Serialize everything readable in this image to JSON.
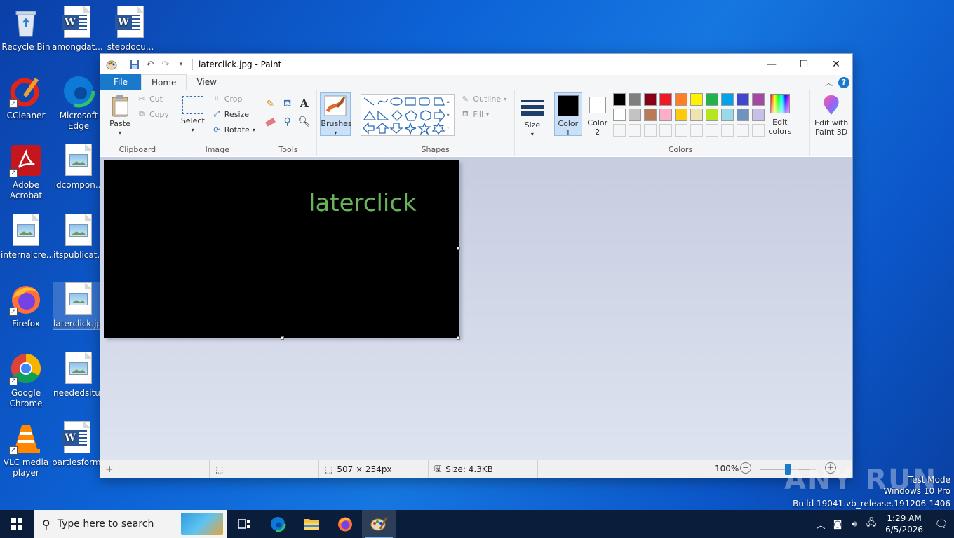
{
  "desktop": {
    "icons": [
      {
        "label": "Recycle Bin"
      },
      {
        "label": "amongdat..."
      },
      {
        "label": "stepdocu..."
      },
      {
        "label": "CCleaner"
      },
      {
        "label": "Microsoft Edge"
      },
      {
        "label": "Adobe Acrobat"
      },
      {
        "label": "idcompon..."
      },
      {
        "label": "internalcre..."
      },
      {
        "label": "itspublicat..."
      },
      {
        "label": "Firefox"
      },
      {
        "label": "laterclick.jpg"
      },
      {
        "label": "Google Chrome"
      },
      {
        "label": "neededsitu..."
      },
      {
        "label": "VLC media player"
      },
      {
        "label": "partiesform..."
      }
    ]
  },
  "paint": {
    "title": "laterclick.jpg - Paint",
    "tabs": {
      "file": "File",
      "home": "Home",
      "view": "View"
    },
    "clipboard": {
      "paste": "Paste",
      "cut": "Cut",
      "copy": "Copy",
      "label": "Clipboard"
    },
    "image": {
      "select": "Select",
      "crop": "Crop",
      "resize": "Resize",
      "rotate": "Rotate",
      "label": "Image"
    },
    "tools": {
      "label": "Tools"
    },
    "brushes": {
      "label": "Brushes"
    },
    "shapes": {
      "outline": "Outline",
      "fill": "Fill",
      "label": "Shapes"
    },
    "size": {
      "label": "Size"
    },
    "colors": {
      "color1": "Color 1",
      "color2": "Color 2",
      "edit": "Edit colors",
      "label": "Colors",
      "color1_value": "#000000",
      "color2_value": "#ffffff",
      "row1": [
        "#000000",
        "#7f7f7f",
        "#880015",
        "#ed1c24",
        "#ff7f27",
        "#fff200",
        "#22b14c",
        "#00a2e8",
        "#3f48cc",
        "#a349a4"
      ],
      "row2": [
        "#ffffff",
        "#c3c3c3",
        "#b97a57",
        "#ffaec9",
        "#ffc90e",
        "#efe4b0",
        "#b5e61d",
        "#99d9ea",
        "#7092be",
        "#c8bfe7"
      ]
    },
    "paint3d": "Edit with Paint 3D",
    "canvas_text": "laterclick",
    "canvas_text_color": "#67b45b",
    "status": {
      "dimensions": "507 × 254px",
      "size": "Size: 4.3KB",
      "zoom": "100%"
    }
  },
  "watermark": {
    "logo": "ANY RUN",
    "line1": "Test Mode",
    "line2": "Windows 10 Pro",
    "line3": "Build 19041.vb_release.191206-1406"
  },
  "taskbar": {
    "search_placeholder": "Type here to search",
    "time": "1:29 AM",
    "date": "6/5/2026"
  }
}
